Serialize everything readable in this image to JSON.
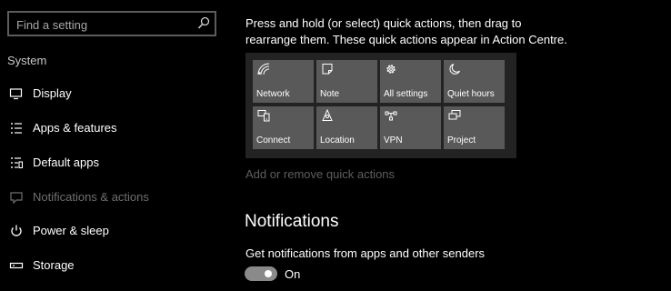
{
  "search": {
    "placeholder": "Find a setting",
    "icon": "search-icon"
  },
  "sidebar": {
    "section": "System",
    "items": [
      {
        "label": "Display",
        "icon": "monitor-icon",
        "active": false
      },
      {
        "label": "Apps & features",
        "icon": "apps-list-icon",
        "active": false
      },
      {
        "label": "Default apps",
        "icon": "default-apps-icon",
        "active": false
      },
      {
        "label": "Notifications & actions",
        "icon": "notification-icon",
        "active": true
      },
      {
        "label": "Power & sleep",
        "icon": "power-icon",
        "active": false
      },
      {
        "label": "Storage",
        "icon": "storage-icon",
        "active": false
      }
    ]
  },
  "main": {
    "intro": "Press and hold (or select) quick actions, then drag to rearrange them. These quick actions appear in Action Centre.",
    "quick_actions": [
      {
        "label": "Network",
        "icon": "network-icon"
      },
      {
        "label": "Note",
        "icon": "note-icon"
      },
      {
        "label": "All settings",
        "icon": "gear-icon"
      },
      {
        "label": "Quiet hours",
        "icon": "moon-icon"
      },
      {
        "label": "Connect",
        "icon": "connect-icon"
      },
      {
        "label": "Location",
        "icon": "location-icon"
      },
      {
        "label": "VPN",
        "icon": "vpn-icon"
      },
      {
        "label": "Project",
        "icon": "project-icon"
      }
    ],
    "add_remove_link": "Add or remove quick actions",
    "notifications_heading": "Notifications",
    "setting_label": "Get notifications from apps and other senders",
    "toggle_state": "On"
  },
  "colors": {
    "background": "#000000",
    "tile": "#595959",
    "panel": "#232323",
    "disabled_text": "#5e5e5e"
  }
}
